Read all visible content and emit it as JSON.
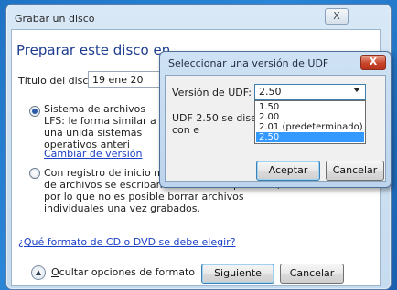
{
  "main": {
    "title": "Grabar un disco",
    "close_label": "X",
    "heading": "Preparar este disco en",
    "disc_title_label": "Título del disco:",
    "disc_title_value": "19 ene 20",
    "option_lfs": "Sistema de archivos LFS: le forma similar a una unida sistemas operativos anteri",
    "change_version_link": "Cambiar de versión",
    "option_mastered": "Con registro de inicio mae algunos reproductores de archivos se escriban en una sola operación, por lo que no es posible borrar archivos individuales una vez grabados.",
    "format_link": "¿Qué formato de CD o DVD se debe elegir?",
    "hide_options_prefix": "O",
    "hide_options_rest": "cultar opciones de formato",
    "next_label": "Siguiente",
    "cancel_label": "Cancelar",
    "tail_text": "no"
  },
  "udf_dialog": {
    "title": "Seleccionar una versión de UDF",
    "close_label": "X",
    "version_label": "Versión de UDF:",
    "selected_value": "2.50",
    "description": "UDF 2.50 se diseñó ser compatible con e",
    "options": [
      "1.50",
      "2.00",
      "2.01 (predeterminado)",
      "2.50"
    ],
    "selected_index": 3,
    "accept_label": "Aceptar",
    "cancel_label": "Cancelar"
  }
}
